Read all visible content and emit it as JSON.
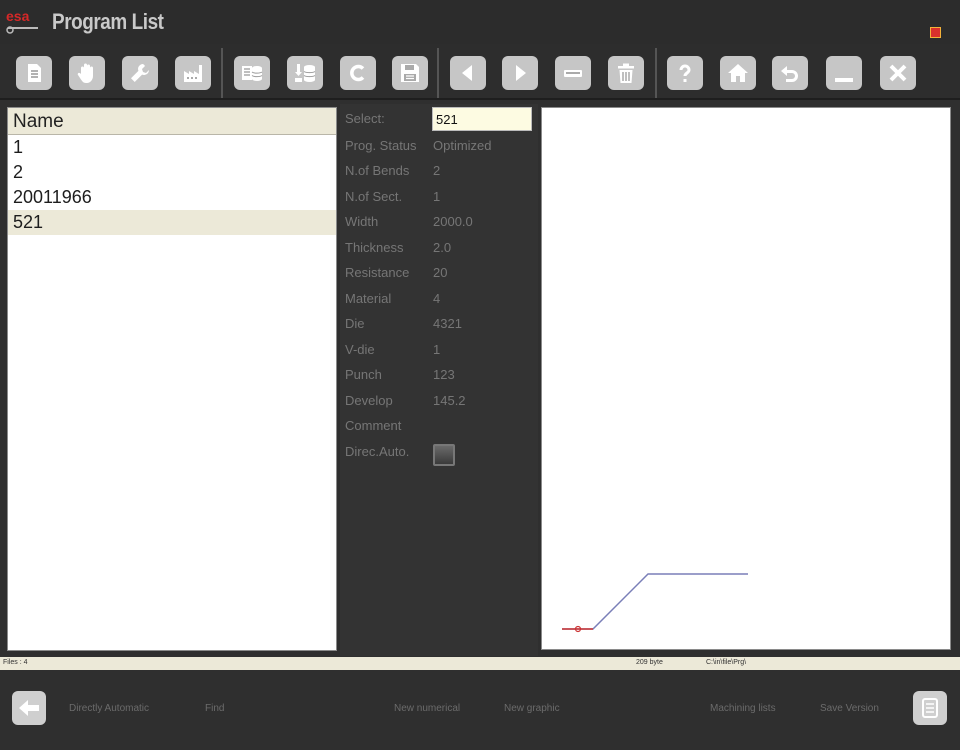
{
  "window": {
    "logo_text": "esa",
    "title": "Program List"
  },
  "toolbar": {
    "buttons": [
      {
        "name": "new-program-button",
        "icon": "document-icon"
      },
      {
        "name": "manual-button",
        "icon": "hand-icon"
      },
      {
        "name": "tooling-button",
        "icon": "wrench-icon"
      },
      {
        "name": "factory-button",
        "icon": "factory-icon"
      },
      {
        "name": "database-list-button",
        "icon": "database-list-icon"
      },
      {
        "name": "database-import-button",
        "icon": "database-import-icon"
      },
      {
        "name": "copy-button",
        "icon": "letter-c-icon",
        "glyph": "C"
      },
      {
        "name": "save-button",
        "icon": "floppy-disk-icon"
      },
      {
        "name": "previous-button",
        "icon": "arrow-left-icon"
      },
      {
        "name": "next-button",
        "icon": "arrow-right-icon"
      },
      {
        "name": "minus-button",
        "icon": "minus-icon"
      },
      {
        "name": "delete-button",
        "icon": "trash-icon"
      },
      {
        "name": "help-button",
        "icon": "question-mark-icon",
        "glyph": "?"
      },
      {
        "name": "home-button",
        "icon": "home-icon"
      },
      {
        "name": "undo-button",
        "icon": "undo-icon"
      },
      {
        "name": "minimize-button",
        "icon": "minimize-icon"
      },
      {
        "name": "close-button",
        "icon": "close-icon"
      }
    ]
  },
  "program_list": {
    "header": "Name",
    "rows": [
      "1",
      "2",
      "20011966",
      "521"
    ],
    "selected_index": 3
  },
  "properties": {
    "select_label": "Select:",
    "select_value": "521",
    "rows": [
      {
        "label": "Prog. Status",
        "value": "Optimized"
      },
      {
        "label": "N.of Bends",
        "value": "2"
      },
      {
        "label": "N.of Sect.",
        "value": "1"
      },
      {
        "label": "Width",
        "value": "2000.0"
      },
      {
        "label": "Thickness",
        "value": "2.0"
      },
      {
        "label": "Resistance",
        "value": "20"
      },
      {
        "label": "Material",
        "value": "4"
      },
      {
        "label": "Die",
        "value": "4321"
      },
      {
        "label": "V-die",
        "value": "1"
      },
      {
        "label": "Punch",
        "value": "123"
      },
      {
        "label": "Develop",
        "value": "145.2"
      },
      {
        "label": "Comment",
        "value": ""
      }
    ],
    "direc_auto_label": "Direc.Auto."
  },
  "status_bar": {
    "files": "Files : 4",
    "size": "209 byte",
    "path": "C:\\in\\file\\Prg\\"
  },
  "bottom_bar": {
    "back_icon": "arrow-left-icon",
    "labels": [
      "Directly Automatic",
      "Find",
      "New numerical",
      "New graphic",
      "Machining lists",
      "Save Version"
    ],
    "doc_icon": "document-icon"
  },
  "colors": {
    "background": "#2f2f2f",
    "button": "#c6c6c6",
    "panel": "#ffffff",
    "selected_row": "#ece9d8",
    "profile_line": "#7a7fb8",
    "profile_marker": "#cc3333"
  }
}
